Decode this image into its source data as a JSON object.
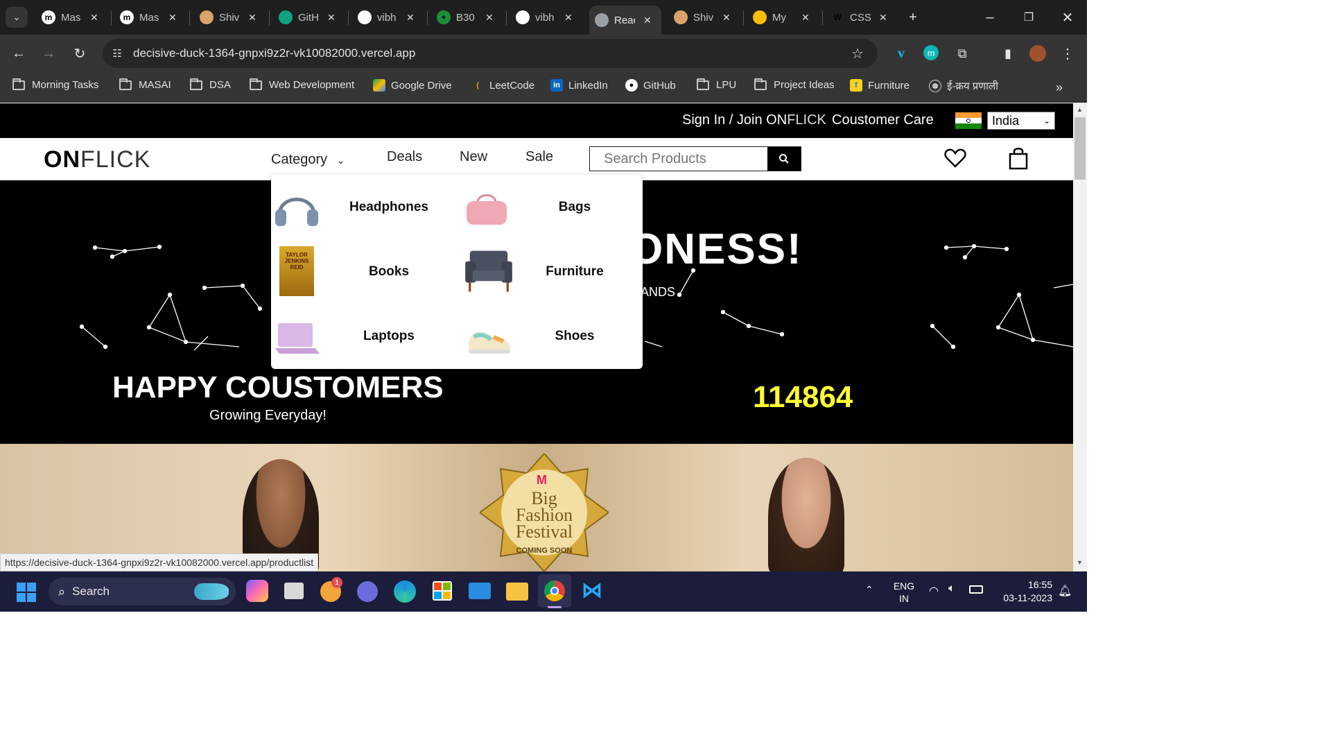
{
  "browser": {
    "tabs": [
      {
        "title": "Mas",
        "fav": "m",
        "favbg": "#ffffff"
      },
      {
        "title": "Mas",
        "fav": "m",
        "favbg": "#ffffff"
      },
      {
        "title": "Shiv",
        "fav": "",
        "favbg": "#d9a36a"
      },
      {
        "title": "GitH",
        "fav": "",
        "favbg": "#10a37f"
      },
      {
        "title": "vibh",
        "fav": "",
        "favbg": "#ffffff"
      },
      {
        "title": "B30",
        "fav": "+",
        "favbg": "#1e8e3e"
      },
      {
        "title": "vibh",
        "fav": "",
        "favbg": "#ffffff"
      },
      {
        "title": "Reac",
        "fav": "",
        "favbg": "#9aa0a6"
      },
      {
        "title": "Shiv",
        "fav": "",
        "favbg": "#d9a36a"
      },
      {
        "title": "My",
        "fav": "",
        "favbg": "#fbbc04"
      },
      {
        "title": "CSS",
        "fav": "W",
        "favbg": "#1f1f1f"
      }
    ],
    "url": "decisive-duck-1364-gnpxi9z2r-vk10082000.vercel.app",
    "bookmarks": [
      "Morning Tasks",
      "MASAI",
      "DSA",
      "Web Development",
      "Google Drive",
      "LeetCode",
      "LinkedIn",
      "GitHub",
      "LPU",
      "Project Ideas",
      "Furniture",
      "ई-क्रय प्रणाली"
    ],
    "status_url": "https://decisive-duck-1364-gnpxi9z2r-vk10082000.vercel.app/productlist"
  },
  "site": {
    "signin_prefix": "Sign In / Join ON",
    "signin_brand": "FLICK",
    "customer_care": "Coustomer Care",
    "country": "India",
    "logo_on": "ON",
    "logo_flick": "FLICK",
    "nav": {
      "category": "Category",
      "deals": "Deals",
      "new": "New",
      "sale": "Sale"
    },
    "search_placeholder": "Search Products",
    "hero_headline_partial": "ONESS!",
    "hero_sub_partial": "ANDS",
    "happy_title": "HAPPY COUSTOMERS",
    "happy_sub": "Growing Everyday!",
    "counter": "114864",
    "banner_badge": [
      "Big",
      "Fashion",
      "Festival"
    ],
    "banner_coming": "COMING SOON",
    "dropdown": [
      {
        "label": "Headphones"
      },
      {
        "label": "Bags"
      },
      {
        "label": "Books"
      },
      {
        "label": "Furniture"
      },
      {
        "label": "Laptops"
      },
      {
        "label": "Shoes"
      }
    ],
    "book_cover": "TAYLOR JENKINS REID"
  },
  "taskbar": {
    "search": "Search",
    "lang": "ENG",
    "region": "IN",
    "time": "16:55",
    "date": "03-11-2023"
  },
  "colors": {
    "brand_accent": "#ffff33",
    "dark": "#000000"
  }
}
